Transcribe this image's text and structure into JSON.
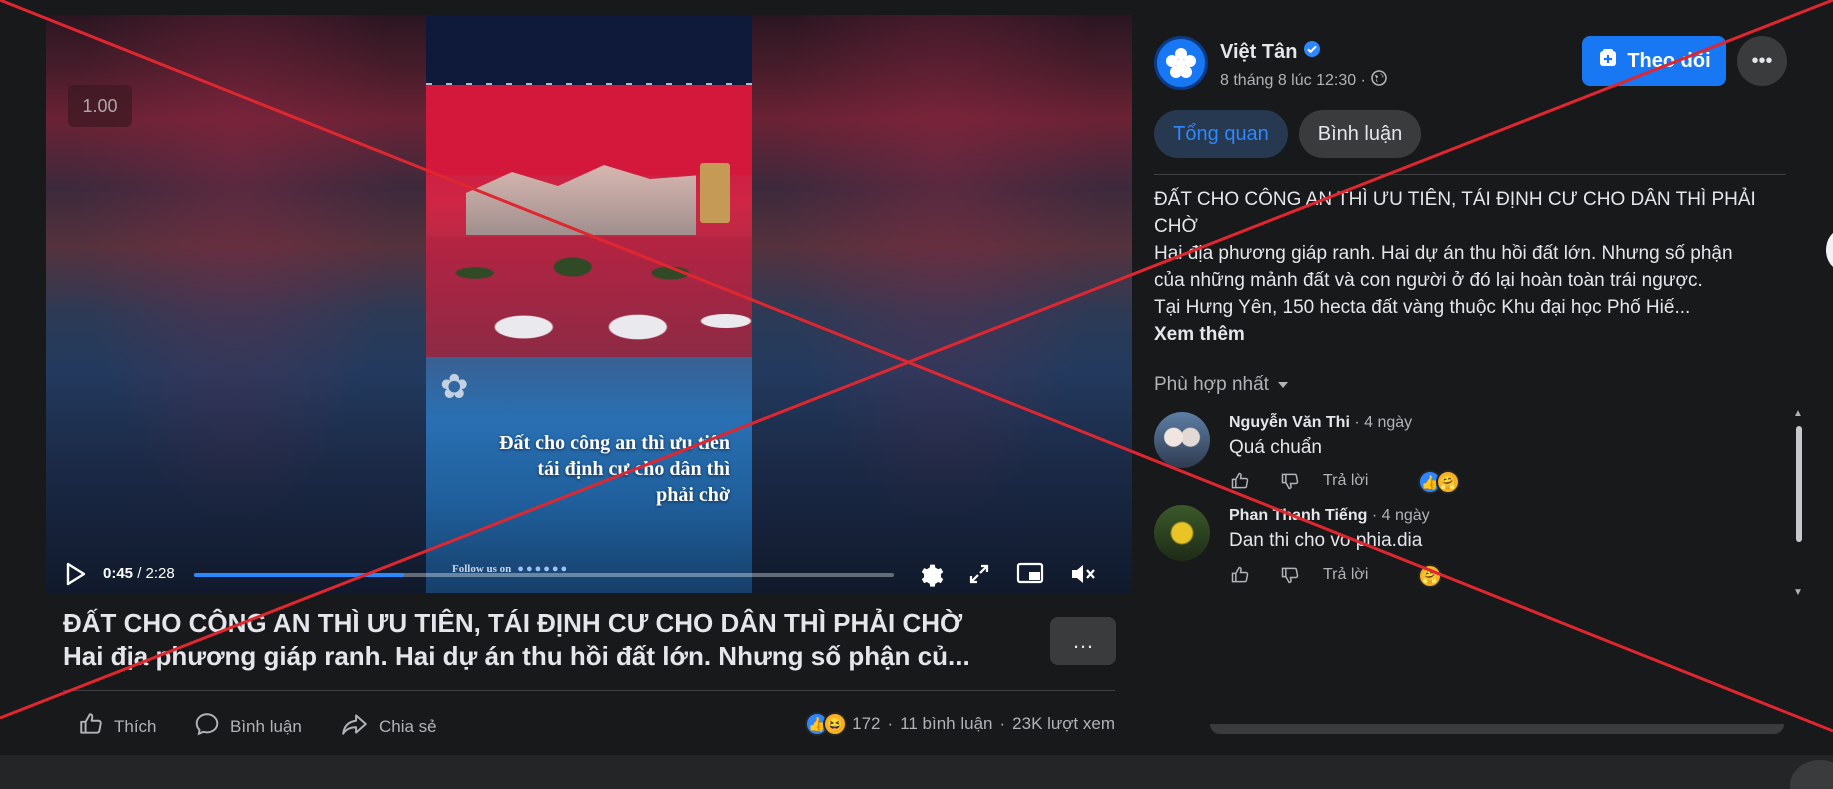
{
  "video": {
    "speed": "1.00",
    "frame_line1": "Đất cho công an thì ưu tiên",
    "frame_line2": "tái định cư cho dân thì",
    "frame_line3": "phải chờ",
    "frame_follow": "Follow us on",
    "time_current": "0:45",
    "time_total": "/ 2:28",
    "progress_fraction": 0.3
  },
  "post": {
    "title": "ĐẤT CHO CÔNG AN THÌ ƯU TIÊN, TÁI ĐỊNH CƯ CHO DÂN THÌ PHẢI CHỜ",
    "subtitle": "Hai địa phương giáp ranh. Hai dự án thu hồi đất lớn. Nhưng số phận củ...",
    "more_icon": "…",
    "actions": {
      "like": "Thích",
      "comment": "Bình luận",
      "share": "Chia sẻ"
    },
    "reactions_count": "172",
    "comments_count": "11 bình luận",
    "views": "23K lượt xem"
  },
  "sidebar": {
    "author": "Việt Tân",
    "meta": "8 tháng 8 lúc 12:30 ·",
    "follow_label": "Theo dõi",
    "tabs": {
      "overview": "Tổng quan",
      "comments": "Bình luận"
    },
    "description": [
      "ĐẤT CHO CÔNG AN THÌ ƯU TIÊN, TÁI ĐỊNH CƯ CHO DÂN THÌ PHẢI",
      "CHỜ",
      "Hai địa phương giáp ranh. Hai dự án thu hồi đất lớn. Nhưng số phận",
      "của những mảnh đất và con người ở đó lại hoàn toàn trái ngược.",
      "Tại Hưng Yên, 150 hecta đất vàng thuộc Khu đại học Phố Hiế..."
    ],
    "see_more": "Xem thêm",
    "sort_label": "Phù hợp nhất",
    "reply_label": "Trả lời",
    "comments": [
      {
        "name": "Nguyễn Văn Thi",
        "age": " · 4 ngày",
        "text": "Quá chuẩn"
      },
      {
        "name": "Phan Thanh Tiếng",
        "age": " · 4 ngày",
        "text": "Dan thi cho vo phia.dia"
      }
    ]
  },
  "colors": {
    "accent": "#1877f2",
    "overlay_x": "#e0262f",
    "background": "#18191a"
  }
}
